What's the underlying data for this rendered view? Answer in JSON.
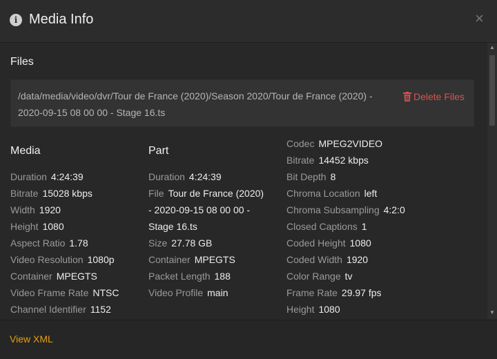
{
  "header": {
    "title": "Media Info",
    "info_icon": "i",
    "close": "×"
  },
  "files": {
    "heading": "Files",
    "path": "/data/media/video/dvr/Tour de France (2020)/Season 2020/Tour de France (2020) - 2020-09-15 08 00 00 - Stage 16.ts",
    "delete_label": "Delete Files"
  },
  "media": {
    "heading": "Media",
    "rows": [
      {
        "k": "Duration",
        "v": "4:24:39"
      },
      {
        "k": "Bitrate",
        "v": "15028 kbps"
      },
      {
        "k": "Width",
        "v": "1920"
      },
      {
        "k": "Height",
        "v": "1080"
      },
      {
        "k": "Aspect Ratio",
        "v": "1.78"
      },
      {
        "k": "Video Resolution",
        "v": "1080p"
      },
      {
        "k": "Container",
        "v": "MPEGTS"
      },
      {
        "k": "Video Frame Rate",
        "v": "NTSC"
      },
      {
        "k": "Channel Identifier",
        "v": "1152"
      }
    ]
  },
  "part": {
    "heading": "Part",
    "rows": [
      {
        "k": "Duration",
        "v": "4:24:39"
      },
      {
        "k": "File",
        "v": "Tour de France (2020)"
      },
      {
        "k": "",
        "v": "- 2020-09-15 08 00 00 -"
      },
      {
        "k": "",
        "v": "Stage 16.ts"
      },
      {
        "k": "Size",
        "v": "27.78 GB"
      },
      {
        "k": "Container",
        "v": "MPEGTS"
      },
      {
        "k": "Packet Length",
        "v": "188"
      },
      {
        "k": "Video Profile",
        "v": "main"
      }
    ]
  },
  "stream": {
    "rows": [
      {
        "k": "Codec",
        "v": "MPEG2VIDEO"
      },
      {
        "k": "Bitrate",
        "v": "14452 kbps"
      },
      {
        "k": "Bit Depth",
        "v": "8"
      },
      {
        "k": "Chroma Location",
        "v": "left"
      },
      {
        "k": "Chroma Subsampling",
        "v": "4:2:0"
      },
      {
        "k": "Closed Captions",
        "v": "1"
      },
      {
        "k": "Coded Height",
        "v": "1080"
      },
      {
        "k": "Coded Width",
        "v": "1920"
      },
      {
        "k": "Color Range",
        "v": "tv"
      },
      {
        "k": "Frame Rate",
        "v": "29.97 fps"
      },
      {
        "k": "Height",
        "v": "1080"
      }
    ]
  },
  "footer": {
    "view_xml": "View XML"
  },
  "colors": {
    "accent": "#e5a00d",
    "danger": "#d9534f"
  }
}
